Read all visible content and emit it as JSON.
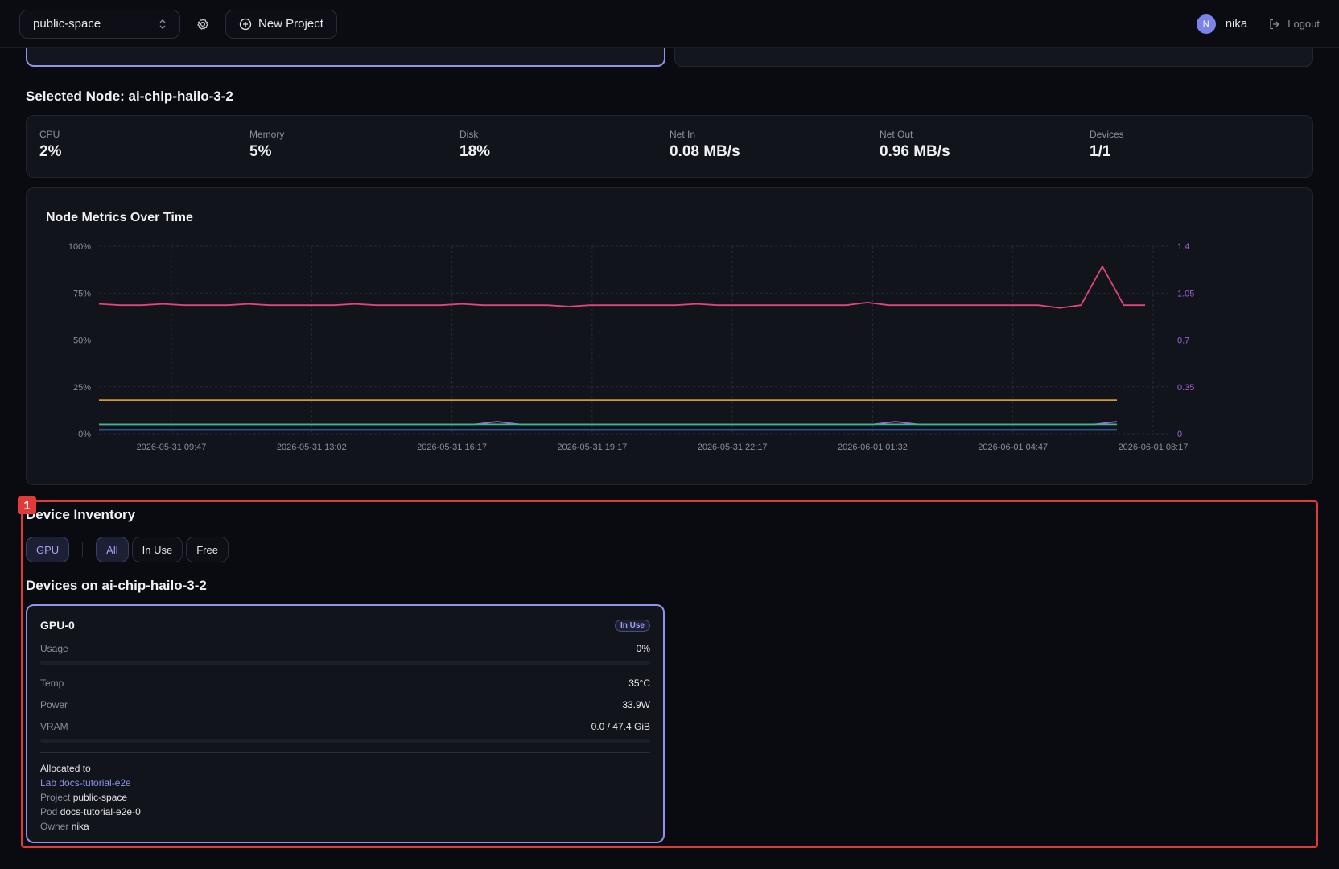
{
  "header": {
    "namespace": "public-space",
    "new_project_label": "New Project",
    "avatar_initial": "N",
    "username": "nika",
    "logout_label": "Logout"
  },
  "selected_node": {
    "title": "Selected Node: ai-chip-hailo-3-2",
    "stats": [
      {
        "label": "CPU",
        "value": "2%"
      },
      {
        "label": "Memory",
        "value": "5%"
      },
      {
        "label": "Disk",
        "value": "18%"
      },
      {
        "label": "Net In",
        "value": "0.08 MB/s"
      },
      {
        "label": "Net Out",
        "value": "0.96 MB/s"
      },
      {
        "label": "Devices",
        "value": "1/1"
      }
    ]
  },
  "chart_data": {
    "type": "line",
    "title": "Node Metrics Over Time",
    "x_ticks": [
      "2026-05-31 09:47",
      "2026-05-31 13:02",
      "2026-05-31 16:17",
      "2026-05-31 19:17",
      "2026-05-31 22:17",
      "2026-06-01 01:32",
      "2026-06-01 04:47",
      "2026-06-01 08:17"
    ],
    "y_left_ticks": [
      "100%",
      "75%",
      "50%",
      "25%",
      "0%"
    ],
    "y_right_ticks": [
      "1.4",
      "1.05",
      "0.7",
      "0.35",
      "0"
    ],
    "ylim_left": [
      0,
      100
    ],
    "ylim_right": [
      0,
      1.4
    ],
    "grid": true,
    "series": [
      {
        "color": "#e2457a",
        "axis": "right",
        "values": [
          0.97,
          0.96,
          0.96,
          0.97,
          0.96,
          0.96,
          0.96,
          0.97,
          0.96,
          0.96,
          0.96,
          0.96,
          0.97,
          0.96,
          0.96,
          0.96,
          0.96,
          0.97,
          0.96,
          0.96,
          0.96,
          0.96,
          0.95,
          0.96,
          0.96,
          0.96,
          0.96,
          0.96,
          0.97,
          0.96,
          0.96,
          0.96,
          0.96,
          0.96,
          0.96,
          0.96,
          0.98,
          0.96,
          0.96,
          0.96,
          0.96,
          0.96,
          0.96,
          0.96,
          0.96,
          0.94,
          0.96,
          1.25,
          0.96,
          0.96
        ]
      },
      {
        "color": "#d39a2f",
        "axis": "left",
        "values": [
          18,
          18,
          18,
          18,
          18,
          18,
          18,
          18,
          18,
          18,
          18,
          18,
          18,
          18,
          18,
          18,
          18,
          18,
          18,
          18,
          18,
          18,
          18,
          18,
          18,
          18,
          18,
          18,
          18,
          18,
          18,
          18,
          18,
          18,
          18,
          18,
          18,
          18,
          18,
          18,
          18,
          18,
          18,
          18,
          18,
          18,
          18
        ]
      },
      {
        "color": "#a25fd8",
        "axis": "right",
        "values": [
          0.07,
          0.07,
          0.07,
          0.07,
          0.07,
          0.07,
          0.07,
          0.07,
          0.07,
          0.07,
          0.07,
          0.07,
          0.07,
          0.07,
          0.07,
          0.07,
          0.07,
          0.07,
          0.09,
          0.07,
          0.07,
          0.07,
          0.07,
          0.07,
          0.07,
          0.07,
          0.07,
          0.07,
          0.07,
          0.07,
          0.07,
          0.07,
          0.07,
          0.07,
          0.07,
          0.07,
          0.09,
          0.07,
          0.07,
          0.07,
          0.07,
          0.07,
          0.07,
          0.07,
          0.07,
          0.07,
          0.09
        ]
      },
      {
        "color": "#3fb98a",
        "axis": "left",
        "values": [
          5,
          5,
          5,
          5,
          5,
          5,
          5,
          5,
          5,
          5,
          5,
          5,
          5,
          5,
          5,
          5,
          5,
          5,
          5,
          5,
          5,
          5,
          5,
          5,
          5,
          5,
          5,
          5,
          5,
          5,
          5,
          5,
          5,
          5,
          5,
          5,
          5,
          5,
          5,
          5,
          5,
          5,
          5,
          5,
          5,
          5,
          5
        ]
      },
      {
        "color": "#3b7bea",
        "axis": "left",
        "values": [
          2,
          2,
          2,
          2,
          2,
          2,
          2,
          2,
          2,
          2,
          2,
          2,
          2,
          2,
          2,
          2,
          2,
          2,
          2,
          2,
          2,
          2,
          2,
          2,
          2,
          2,
          2,
          2,
          2,
          2,
          2,
          2,
          2,
          2,
          2,
          2,
          2,
          2,
          2,
          2,
          2,
          2,
          2,
          2,
          2,
          2,
          2
        ]
      }
    ]
  },
  "inventory": {
    "title": "Device Inventory",
    "marker": "1",
    "type_filter": "GPU",
    "filters": [
      "All",
      "In Use",
      "Free"
    ],
    "devices_title": "Devices on ai-chip-hailo-3-2",
    "device": {
      "name": "GPU-0",
      "status": "In Use",
      "usage_label": "Usage",
      "usage_value": "0%",
      "temp_label": "Temp",
      "temp_value": "35°C",
      "power_label": "Power",
      "power_value": "33.9W",
      "vram_label": "VRAM",
      "vram_value": "0.0 / 47.4 GiB",
      "allocated_label": "Allocated to",
      "lab_link": "Lab docs-tutorial-e2e",
      "project_label": "Project",
      "project_value": "public-space",
      "pod_label": "Pod",
      "pod_value": "docs-tutorial-e2e-0",
      "owner_label": "Owner",
      "owner_value": "nika"
    }
  }
}
